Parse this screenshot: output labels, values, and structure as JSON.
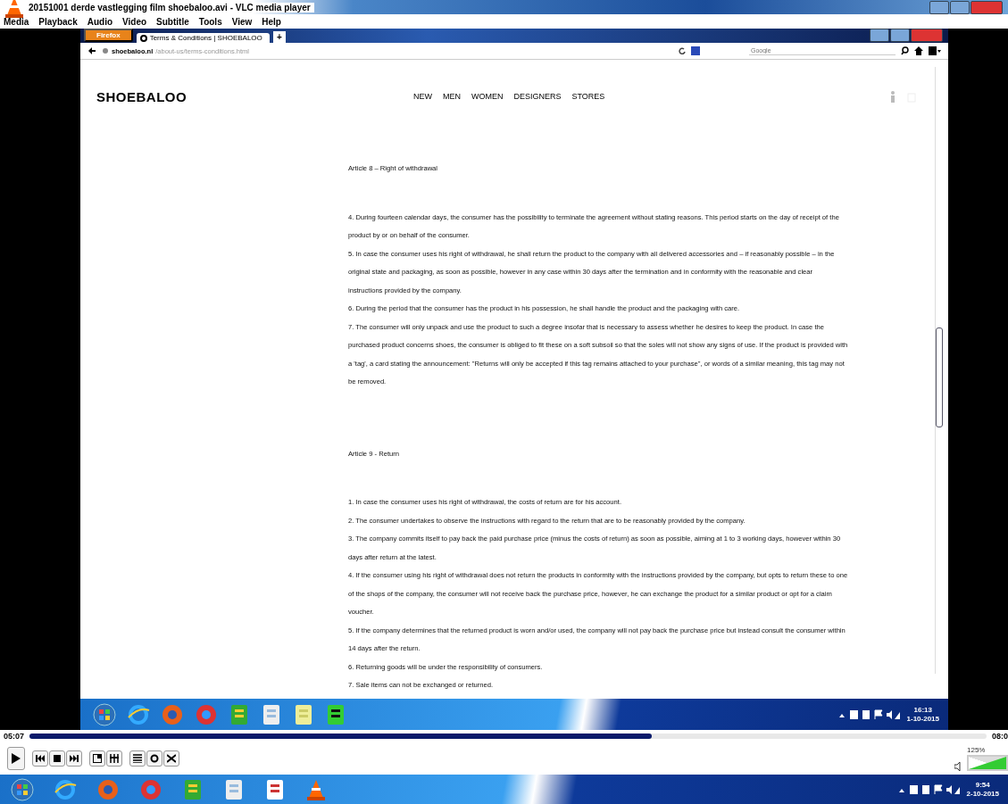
{
  "player": {
    "title": "20151001 derde vastlegging film shoebaloo.avi - VLC media player",
    "menu": [
      "Media",
      "Playback",
      "Audio",
      "Video",
      "Subtitle",
      "Tools",
      "View",
      "Help"
    ]
  },
  "browser": {
    "app_button": "Firefox",
    "tabs": [
      {
        "label": "Terms & Conditions | SHOEBALOO",
        "selected": true
      }
    ],
    "new_tab": "+",
    "url_host": "shoebaloo.nl",
    "url_path": "/about-us/terms-conditions.html",
    "search_placeholder": "Google"
  },
  "site": {
    "logo": "SHOEBALOO",
    "nav": [
      "NEW",
      "MEN",
      "WOMEN",
      "DESIGNERS",
      "STORES"
    ],
    "sections": [
      {
        "heading": "Article 8 – Right of withdrawal",
        "paragraphs": [
          "4. During fourteen calendar days, the consumer has the possibility to terminate the agreement without stating reasons. This period starts on the day of receipt of the product by or on behalf of the consumer.",
          "5. In case the consumer uses his right of withdrawal, he shall return the product to the company with all delivered accessories and – if reasonably possible – in the original state and packaging, as soon as possible, however in any case within 30 days after the termination and in conformity with the reasonable and clear instructions provided by the company.",
          "6. During the period that the consumer has the product in his possession, he shall handle the product and the packaging with care.",
          "7. The consumer will only unpack and use the product to such a degree insofar that is necessary to assess whether he desires to keep the product. In case the purchased product concerns shoes, the consumer is obliged to fit these on a soft subsoil so that the soles will not show any signs of use. If the product is provided with a 'tag', a card stating the announcement: \"Returns will only be accepted if this tag remains attached to your purchase\", or words of a similar meaning, this tag may not be removed."
        ]
      },
      {
        "heading": "Article 9 - Return",
        "paragraphs": [
          "1. In case the consumer uses his right of withdrawal, the costs of return are for his account.",
          "2. The consumer undertakes to observe the instructions with regard to the return that are to be reasonably provided by the company.",
          "3. The company commits itself to pay back the paid purchase price (minus the costs of return) as soon as possible, aiming at 1 to 3 working days, however within 30 days after return at the latest.",
          "4. If the consumer using his right of withdrawal does not return the products in conformity with the instructions provided by the company, but opts to return these to one of the shops of the company, the consumer will not receive back the purchase price, however, he can exchange the product for a similar product or opt for a claim voucher.",
          "5. If the company determines that the returned product is worn and/or used, the company will not pay back the purchase price but instead consult the consumer within 14 days after the return.",
          "6. Returning goods will be under the responsibility of consumers.",
          "7. Sale items can not be exchanged or returned."
        ]
      }
    ]
  },
  "inner_taskbar": {
    "time": "16:13",
    "date": "1-10-2015"
  },
  "seek": {
    "elapsed": "05:07",
    "total": "08:0",
    "level": 0.65
  },
  "volume": {
    "reading": "125%",
    "level": 1
  },
  "outer_taskbar": {
    "time": "9:54",
    "date": "2-10-2015"
  }
}
